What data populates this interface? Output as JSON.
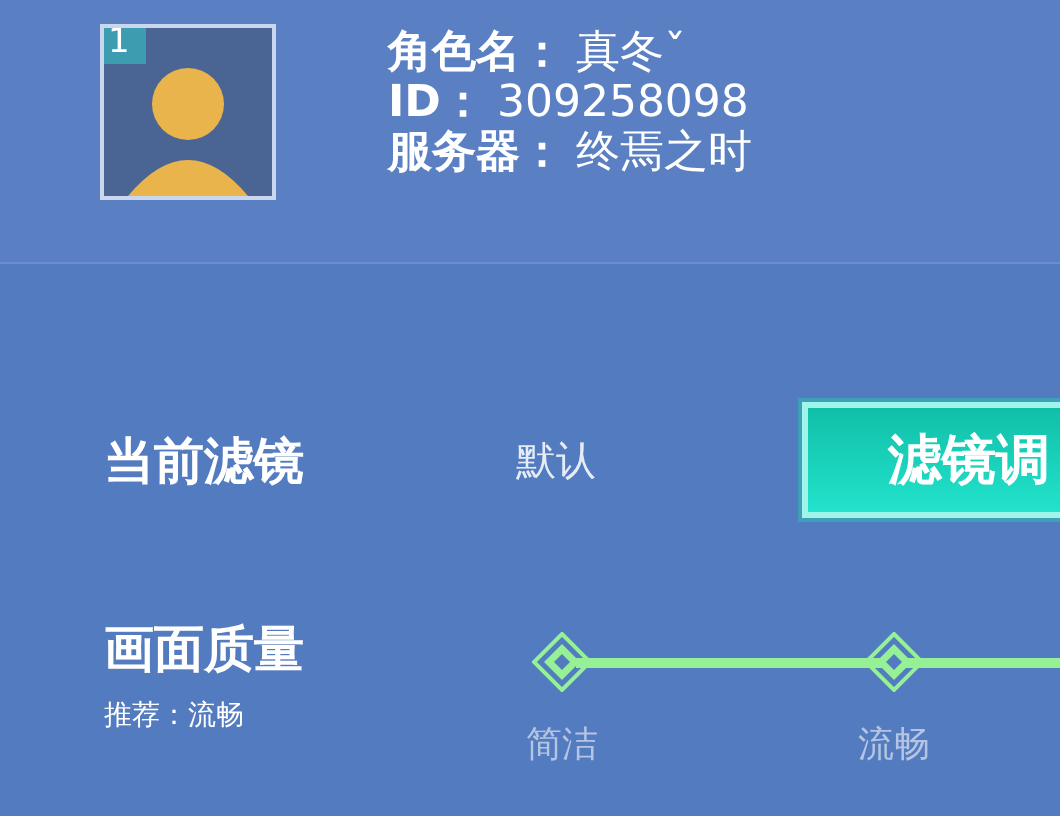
{
  "profile": {
    "rank_badge": "1",
    "name_label": "角色名：",
    "name": "真冬ˇ",
    "id_label": "ID：",
    "id": "309258098",
    "server_label": "服务器：",
    "server": "终焉之时"
  },
  "filter": {
    "label": "当前滤镜",
    "current": "默认",
    "button": "滤镜调"
  },
  "quality": {
    "label": "画面质量",
    "recommendation": "推荐：流畅",
    "stops": [
      {
        "label": "简洁"
      },
      {
        "label": "流畅"
      }
    ]
  }
}
